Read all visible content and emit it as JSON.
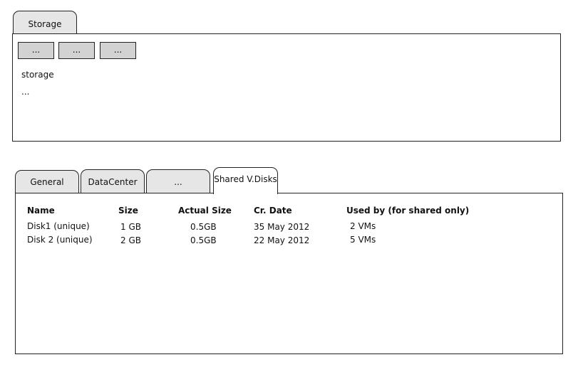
{
  "top": {
    "tab_label": "Storage",
    "buttons": [
      "...",
      "...",
      "..."
    ],
    "content_label": "storage",
    "content_more": "..."
  },
  "bottom": {
    "tabs": [
      "General",
      "DataCenter",
      "...",
      "Shared V.Disks"
    ],
    "active_tab": "Shared V.Disks",
    "table": {
      "headers": [
        "Name",
        "Size",
        "Actual Size",
        "Cr. Date",
        "Used by (for shared only)"
      ],
      "rows": [
        [
          "Disk1 (unique)",
          "1 GB",
          "0.5GB",
          "35 May 2012",
          "2 VMs"
        ],
        [
          "Disk 2 (unique)",
          "2 GB",
          "0.5GB",
          "22 May 2012",
          "5 VMs"
        ]
      ]
    }
  }
}
